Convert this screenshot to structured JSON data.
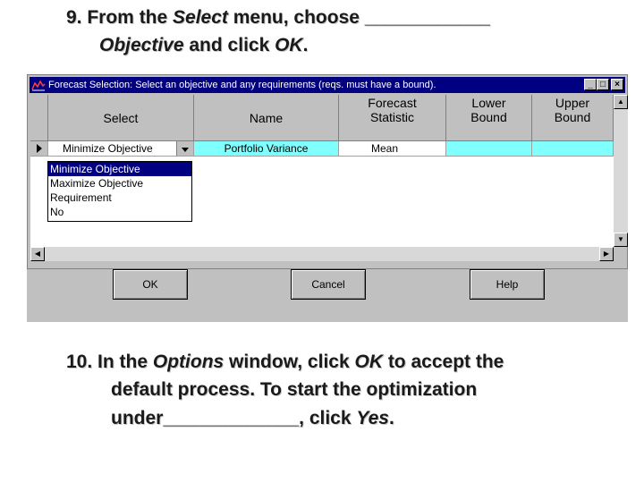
{
  "step9": {
    "number": "9.",
    "line1_a": "From the ",
    "line1_em": "Select",
    "line1_b": " menu, choose ____________",
    "line2_em": "Objective",
    "line2_b": " and click ",
    "line2_em2": "OK",
    "line2_c": "."
  },
  "dialog": {
    "title": "Forecast Selection: Select an objective and any requirements (reqs. must have a bound).",
    "app_icon": "chart-icon",
    "title_buttons": [
      "minimize-icon",
      "maximize-icon",
      "close-icon"
    ],
    "columns": {
      "select": "Select",
      "name": "Name",
      "forecast_1": "Forecast",
      "forecast_2": "Statistic",
      "lower_1": "Lower",
      "lower_2": "Bound",
      "upper_1": "Upper",
      "upper_2": "Bound"
    },
    "row": {
      "select": "Minimize Objective",
      "name": "Portfolio Variance",
      "statistic": "Mean",
      "lower": "",
      "upper": ""
    },
    "dropdown_options": [
      "Minimize Objective",
      "Maximize Objective",
      "Requirement",
      "No"
    ],
    "selected_option": "Minimize Objective",
    "buttons": {
      "ok": "OK",
      "cancel": "Cancel",
      "help": "Help"
    },
    "colors": {
      "titlebar": "#000080",
      "row_highlight": "#80ffff",
      "dialog_bg": "#c0c0c0"
    }
  },
  "step10": {
    "number": "10.",
    "line1_a": "In the ",
    "line1_em": "Options",
    "line1_b": " window, click ",
    "line1_em2": "OK",
    "line1_c": " to accept the",
    "line2": "default process.  To start the optimization",
    "line3_a": "under_____________, click ",
    "line3_em": "Yes",
    "line3_b": "."
  }
}
